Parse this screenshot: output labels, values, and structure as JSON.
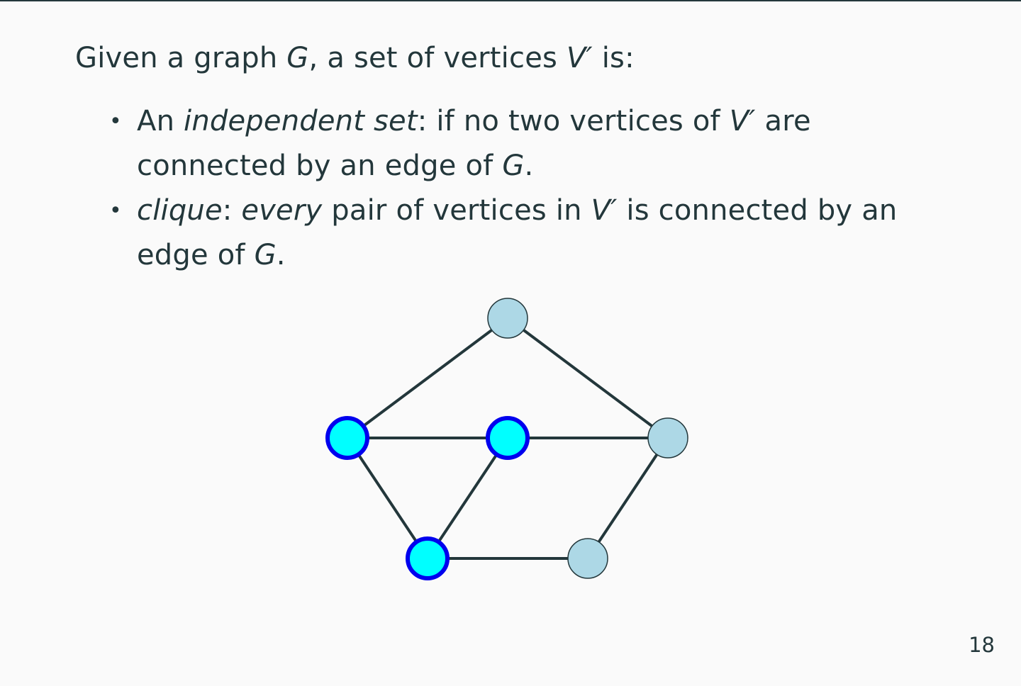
{
  "slide": {
    "intro": {
      "t1": "Given a graph ",
      "g": "G",
      "t2": ", a set of vertices ",
      "v": "V′",
      "t3": " is:"
    },
    "bullets": [
      {
        "dot": "•",
        "pre": "An ",
        "term": "independent set",
        "t1": ": if no two vertices of ",
        "v": "V′",
        "t2": " are connected by an edge of ",
        "g": "G",
        "t3": "."
      },
      {
        "dot": "•",
        "term": "clique",
        "t1": ": ",
        "emph": "every",
        "t2": " pair of vertices in ",
        "v": "V′",
        "t3": " is connected by an edge of ",
        "g": "G",
        "t4": "."
      }
    ],
    "page_number": "18"
  },
  "graph": {
    "colors": {
      "edge": "#23373b",
      "node_fill": "#add8e6",
      "node_stroke": "#23373b",
      "highlight_fill": "#00ffff",
      "highlight_stroke": "#0000ee"
    },
    "nodes": [
      {
        "id": "top",
        "highlighted": false
      },
      {
        "id": "mid-left",
        "highlighted": true
      },
      {
        "id": "mid-center",
        "highlighted": true
      },
      {
        "id": "mid-right",
        "highlighted": false
      },
      {
        "id": "bottom-left",
        "highlighted": true
      },
      {
        "id": "bottom-right",
        "highlighted": false
      }
    ],
    "edges": [
      [
        "top",
        "mid-left"
      ],
      [
        "top",
        "mid-right"
      ],
      [
        "mid-left",
        "mid-center"
      ],
      [
        "mid-center",
        "mid-right"
      ],
      [
        "mid-left",
        "bottom-left"
      ],
      [
        "mid-center",
        "bottom-left"
      ],
      [
        "bottom-left",
        "bottom-right"
      ],
      [
        "mid-right",
        "bottom-right"
      ]
    ]
  }
}
